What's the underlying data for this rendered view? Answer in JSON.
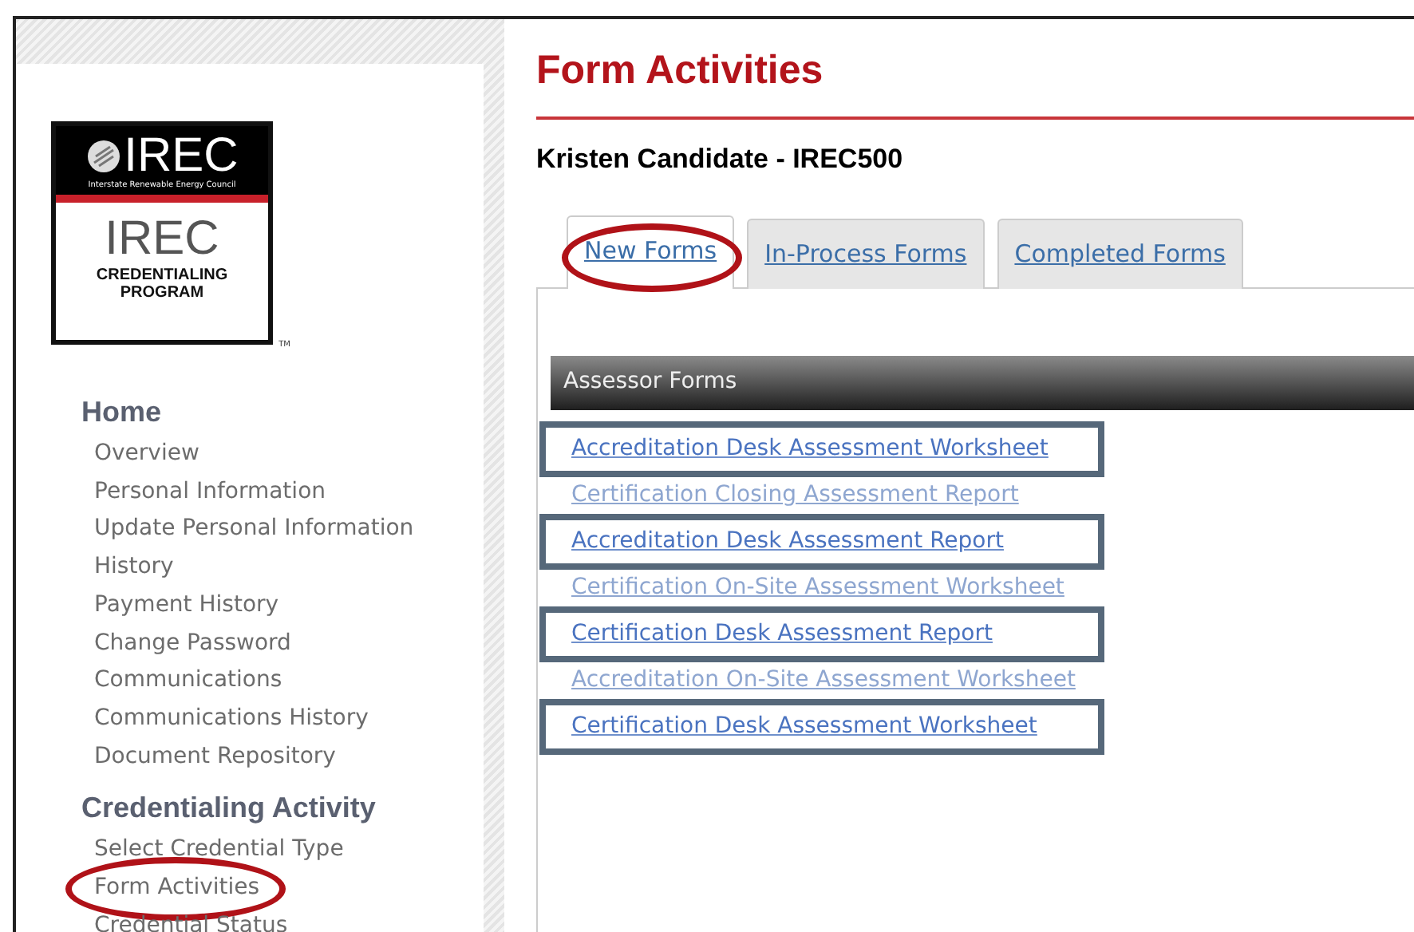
{
  "logo": {
    "top_text": "IREC",
    "council": "Interstate Renewable Energy Council",
    "main_text": "IREC",
    "subtitle": "CREDENTIALING PROGRAM",
    "trademark": "TM"
  },
  "nav": [
    {
      "heading": "Home",
      "items": [
        {
          "label": "Overview",
          "circled": false
        },
        {
          "label": "Personal Information",
          "circled": false
        },
        {
          "label": "Update Personal Information",
          "circled": false
        },
        {
          "label": "History",
          "circled": false
        },
        {
          "label": "Payment History",
          "circled": false
        },
        {
          "label": "Change Password",
          "circled": false
        },
        {
          "label": "Communications",
          "circled": false
        },
        {
          "label": "Communications History",
          "circled": false
        },
        {
          "label": "Document Repository",
          "circled": false
        }
      ]
    },
    {
      "heading": "Credentialing Activity",
      "items": [
        {
          "label": "Select Credential Type",
          "circled": false
        },
        {
          "label": "Form Activities",
          "circled": true
        },
        {
          "label": "Credential Status",
          "circled": false
        }
      ]
    }
  ],
  "page_title": "Form Activities",
  "candidate": "Kristen Candidate - IREC500",
  "tabs": [
    {
      "label": "New Forms",
      "selected": true,
      "circled": true
    },
    {
      "label": "In-Process Forms",
      "selected": false,
      "circled": false
    },
    {
      "label": "Completed Forms",
      "selected": false,
      "circled": false
    }
  ],
  "section": {
    "title": "Assessor Forms",
    "forms": [
      {
        "label": "Accreditation Desk Assessment Worksheet",
        "faded": false,
        "highlighted": true
      },
      {
        "label": "Certification Closing Assessment Report",
        "faded": true,
        "highlighted": false
      },
      {
        "label": "Accreditation Desk Assessment Report",
        "faded": false,
        "highlighted": true
      },
      {
        "label": "Certification On-Site Assessment Worksheet",
        "faded": true,
        "highlighted": false
      },
      {
        "label": "Certification Desk Assessment Report",
        "faded": false,
        "highlighted": true
      },
      {
        "label": "Accreditation On-Site Assessment Worksheet",
        "faded": true,
        "highlighted": false
      },
      {
        "label": "Certification Desk Assessment Worksheet",
        "faded": false,
        "highlighted": true
      }
    ]
  }
}
